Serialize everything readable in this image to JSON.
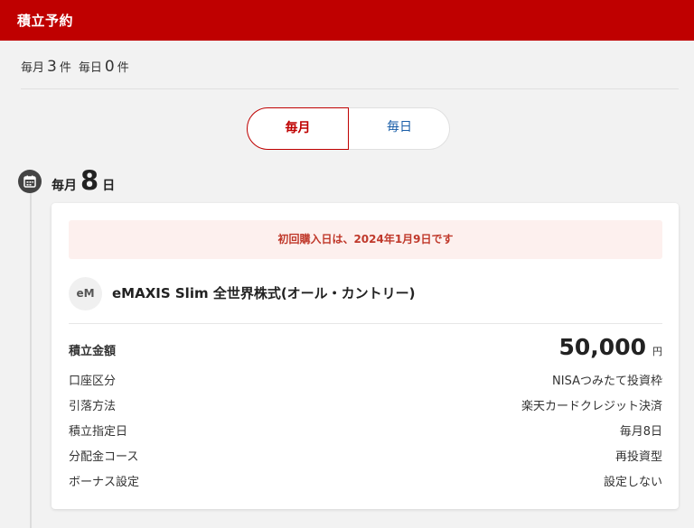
{
  "header": {
    "title": "積立予約"
  },
  "counts": {
    "monthly_label": "毎月",
    "monthly_count": "3",
    "monthly_unit": "件",
    "daily_label": "毎日",
    "daily_count": "0",
    "daily_unit": "件"
  },
  "toggle": {
    "monthly": "毎月",
    "daily": "毎日",
    "selected": "毎月"
  },
  "schedule": {
    "prefix": "毎月",
    "day": "8",
    "suffix": "日"
  },
  "card": {
    "notice": "初回購入日は、2024年1月9日です",
    "fund_icon_text": "eM",
    "fund_name": "eMAXIS Slim 全世界株式(オール・カントリー)",
    "amount_label": "積立金額",
    "amount_value": "50,000",
    "amount_unit": "円",
    "rows": [
      {
        "label": "口座区分",
        "value": "NISAつみたて投資枠"
      },
      {
        "label": "引落方法",
        "value": "楽天カードクレジット決済"
      },
      {
        "label": "積立指定日",
        "value": "毎月8日"
      },
      {
        "label": "分配金コース",
        "value": "再投資型"
      },
      {
        "label": "ボーナス設定",
        "value": "設定しない"
      }
    ]
  },
  "colors": {
    "brand": "#bf0000",
    "link": "#1a5ea8",
    "notice_bg": "#fdf0ee"
  },
  "icons": {
    "schedule": "calendar-icon"
  }
}
